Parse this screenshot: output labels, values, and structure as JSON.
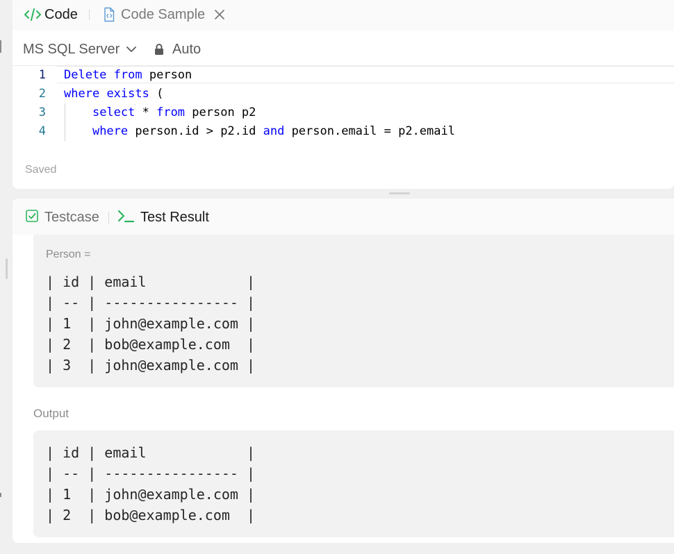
{
  "tabs": {
    "code_label": "Code",
    "sample_label": "Code Sample"
  },
  "toolbar": {
    "language": "MS SQL Server",
    "mode": "Auto"
  },
  "editor": {
    "lines": [
      {
        "num": "1",
        "tokens": [
          {
            "t": "Delete",
            "kw": true
          },
          {
            "t": " ",
            "kw": false
          },
          {
            "t": "from",
            "kw": true
          },
          {
            "t": " person",
            "kw": false
          }
        ]
      },
      {
        "num": "2",
        "tokens": [
          {
            "t": "where",
            "kw": true
          },
          {
            "t": " ",
            "kw": false
          },
          {
            "t": "exists",
            "kw": true
          },
          {
            "t": " (",
            "kw": false
          }
        ]
      },
      {
        "num": "3",
        "tokens": [
          {
            "t": "    ",
            "kw": false
          },
          {
            "t": "select",
            "kw": true
          },
          {
            "t": " * ",
            "kw": false
          },
          {
            "t": "from",
            "kw": true
          },
          {
            "t": " person p2",
            "kw": false
          }
        ]
      },
      {
        "num": "4",
        "tokens": [
          {
            "t": "    ",
            "kw": false
          },
          {
            "t": "where",
            "kw": true
          },
          {
            "t": " person.id > p2.id ",
            "kw": false
          },
          {
            "t": "and",
            "kw": true
          },
          {
            "t": " person.email = p2.email",
            "kw": false
          }
        ]
      }
    ],
    "status": "Saved"
  },
  "result_tabs": {
    "testcase_label": "Testcase",
    "result_label": "Test Result"
  },
  "input": {
    "var_label": "Person =",
    "table_text": "| id | email            |\n| -- | ---------------- |\n| 1  | john@example.com |\n| 2  | bob@example.com  |\n| 3  | john@example.com |"
  },
  "output": {
    "label": "Output",
    "table_text": "| id | email            |\n| -- | ---------------- |\n| 1  | john@example.com |\n| 2  | bob@example.com  |"
  },
  "colors": {
    "accent_green": "#2db55d",
    "keyword_blue": "#0000ff",
    "line_number": "#237893"
  },
  "icons": {
    "code_tab": "code-brackets-icon",
    "sample_tab": "document-icon",
    "close": "close-icon",
    "language_chevron": "chevron-down-icon",
    "mode": "lock-icon",
    "testcase_tab": "checkbox-icon",
    "result_tab": "terminal-icon"
  }
}
